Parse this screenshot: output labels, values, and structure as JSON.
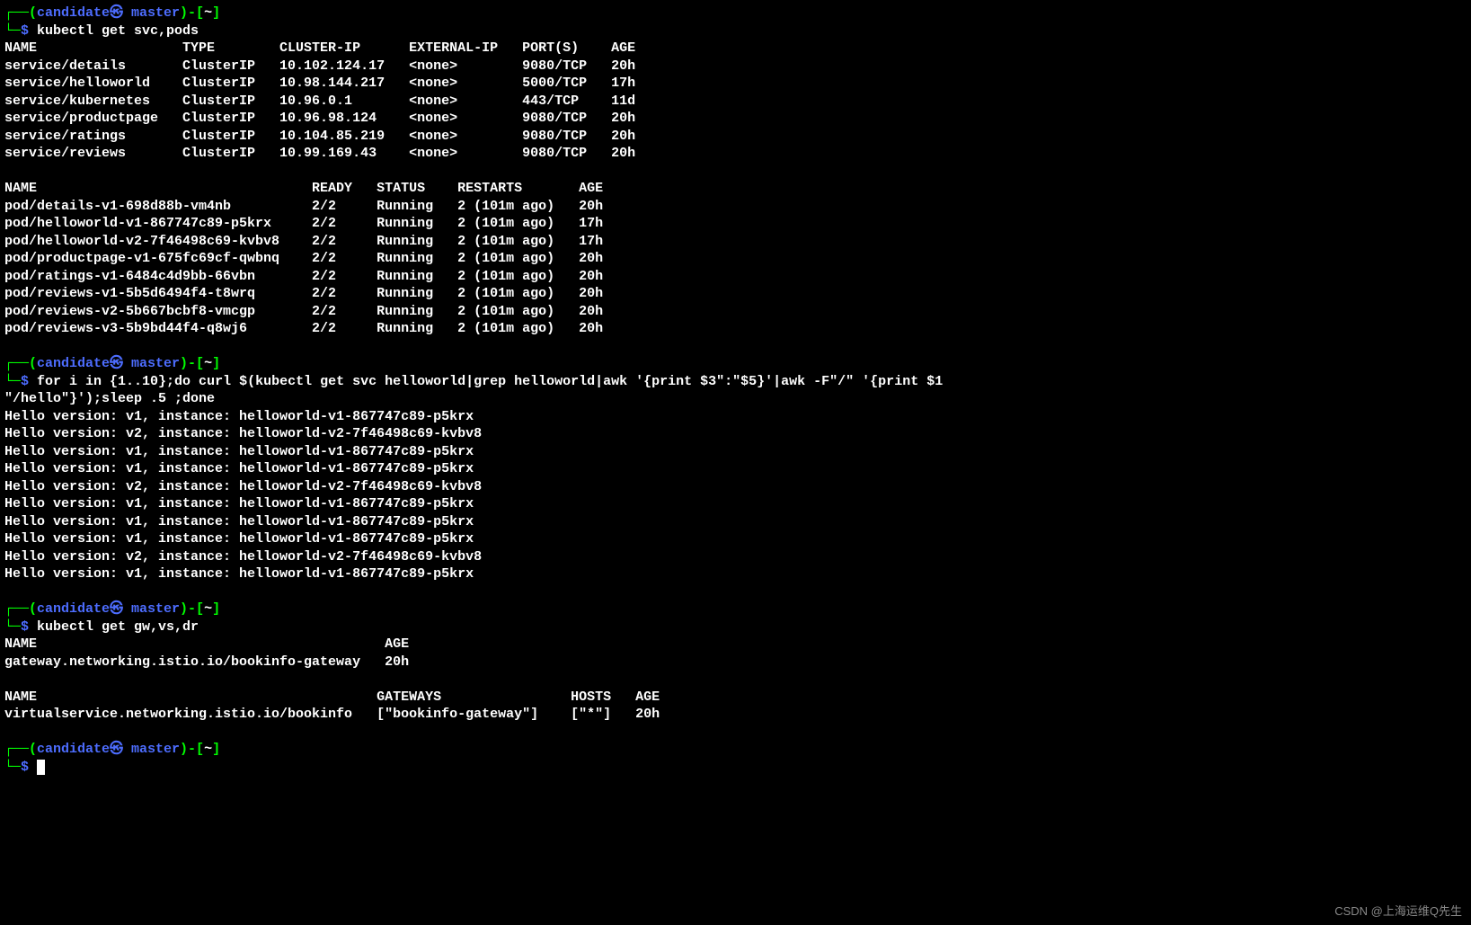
{
  "prompt": {
    "dash1": "┌──(",
    "user": "candidate㉿",
    "host": " master",
    "sep": ")-[",
    "dir": "~",
    "close": "]",
    "dash2": "└─",
    "sym": "$"
  },
  "cmd1": " kubectl get svc,pods",
  "svc_header": "NAME                  TYPE        CLUSTER-IP      EXTERNAL-IP   PORT(S)    AGE",
  "svc_rows": [
    "service/details       ClusterIP   10.102.124.17   <none>        9080/TCP   20h",
    "service/helloworld    ClusterIP   10.98.144.217   <none>        5000/TCP   17h",
    "service/kubernetes    ClusterIP   10.96.0.1       <none>        443/TCP    11d",
    "service/productpage   ClusterIP   10.96.98.124    <none>        9080/TCP   20h",
    "service/ratings       ClusterIP   10.104.85.219   <none>        9080/TCP   20h",
    "service/reviews       ClusterIP   10.99.169.43    <none>        9080/TCP   20h"
  ],
  "pod_header": "NAME                                  READY   STATUS    RESTARTS       AGE",
  "pod_rows": [
    "pod/details-v1-698d88b-vm4nb          2/2     Running   2 (101m ago)   20h",
    "pod/helloworld-v1-867747c89-p5krx     2/2     Running   2 (101m ago)   17h",
    "pod/helloworld-v2-7f46498c69-kvbv8    2/2     Running   2 (101m ago)   17h",
    "pod/productpage-v1-675fc69cf-qwbnq    2/2     Running   2 (101m ago)   20h",
    "pod/ratings-v1-6484c4d9bb-66vbn       2/2     Running   2 (101m ago)   20h",
    "pod/reviews-v1-5b5d6494f4-t8wrq       2/2     Running   2 (101m ago)   20h",
    "pod/reviews-v2-5b667bcbf8-vmcgp       2/2     Running   2 (101m ago)   20h",
    "pod/reviews-v3-5b9bd44f4-q8wj6        2/2     Running   2 (101m ago)   20h"
  ],
  "cmd2_l1": " for i in {1..10};do curl $(kubectl get svc helloworld|grep helloworld|awk '{print $3\":\"$5}'|awk -F\"/\" '{print $1",
  "cmd2_l2": "\"/hello\"}');sleep .5 ;done",
  "hello_rows": [
    "Hello version: v1, instance: helloworld-v1-867747c89-p5krx",
    "Hello version: v2, instance: helloworld-v2-7f46498c69-kvbv8",
    "Hello version: v1, instance: helloworld-v1-867747c89-p5krx",
    "Hello version: v1, instance: helloworld-v1-867747c89-p5krx",
    "Hello version: v2, instance: helloworld-v2-7f46498c69-kvbv8",
    "Hello version: v1, instance: helloworld-v1-867747c89-p5krx",
    "Hello version: v1, instance: helloworld-v1-867747c89-p5krx",
    "Hello version: v1, instance: helloworld-v1-867747c89-p5krx",
    "Hello version: v2, instance: helloworld-v2-7f46498c69-kvbv8",
    "Hello version: v1, instance: helloworld-v1-867747c89-p5krx"
  ],
  "cmd3": " kubectl get gw,vs,dr",
  "gw_header": "NAME                                           AGE",
  "gw_row": "gateway.networking.istio.io/bookinfo-gateway   20h",
  "vs_header": "NAME                                          GATEWAYS                HOSTS   AGE",
  "vs_row": "virtualservice.networking.istio.io/bookinfo   [\"bookinfo-gateway\"]    [\"*\"]   20h",
  "watermark": "CSDN @上海运维Q先生"
}
